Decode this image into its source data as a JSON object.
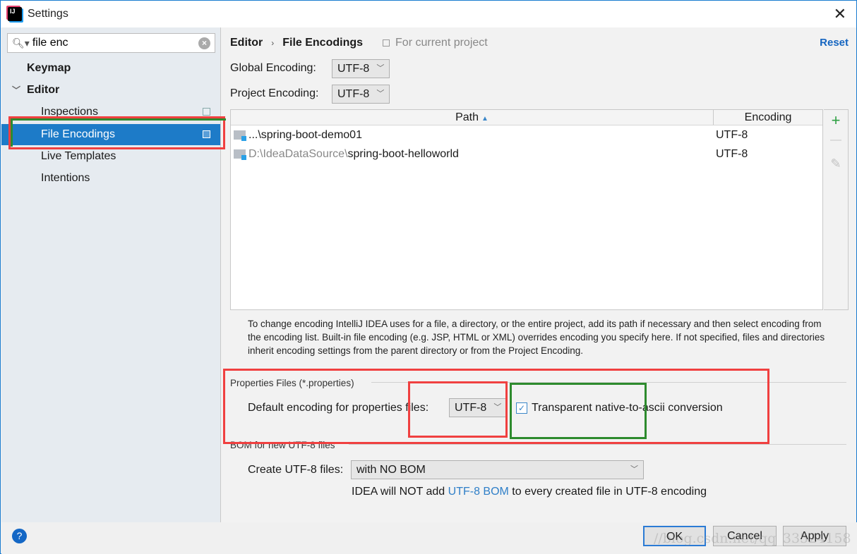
{
  "window": {
    "title": "Settings",
    "close_label": "✕"
  },
  "search": {
    "value": "file enc",
    "placeholder": ""
  },
  "sidebar": {
    "items": [
      {
        "label": "Keymap"
      },
      {
        "label": "Editor"
      },
      {
        "label": "Inspections"
      },
      {
        "label": "File Encodings"
      },
      {
        "label": "Live Templates"
      },
      {
        "label": "Intentions"
      }
    ]
  },
  "breadcrumb": {
    "parent": "Editor",
    "separator": "›",
    "current": "File Encodings",
    "scope": "For current project"
  },
  "reset_label": "Reset",
  "global_encoding": {
    "label": "Global Encoding:",
    "value": "UTF-8"
  },
  "project_encoding": {
    "label": "Project Encoding:",
    "value": "UTF-8"
  },
  "table": {
    "columns": {
      "path": "Path",
      "sort_indicator": "▲",
      "encoding": "Encoding"
    },
    "rows": [
      {
        "path_prefix": "...\\",
        "path_name": "spring-boot-demo01",
        "encoding": "UTF-8"
      },
      {
        "path_prefix": "D:\\IdeaDataSource\\",
        "path_name": "spring-boot-helloworld",
        "encoding": "UTF-8"
      }
    ],
    "tools": {
      "add": "+",
      "remove": "—",
      "edit": "✎"
    }
  },
  "help_text": "To change encoding IntelliJ IDEA uses for a file, a directory, or the entire project, add its path if necessary and then select encoding from the encoding list. Built-in file encoding (e.g. JSP, HTML or XML) overrides encoding you specify here. If not specified, files and directories inherit encoding settings from the parent directory or from the Project Encoding.",
  "properties": {
    "group_title": "Properties Files (*.properties)",
    "default_label": "Default encoding for properties files:",
    "default_value": "UTF-8",
    "native_to_ascii_label": "Transparent native-to-ascii conversion",
    "native_to_ascii_checked": true
  },
  "bom": {
    "group_title": "BOM for new UTF-8 files",
    "create_label": "Create UTF-8 files:",
    "create_value": "with NO BOM",
    "note_prefix": "IDEA will NOT add ",
    "note_link": "UTF-8 BOM",
    "note_suffix": " to every created file in UTF-8 encoding"
  },
  "footer": {
    "help": "?",
    "ok": "OK",
    "cancel": "Cancel",
    "apply": "Apply"
  },
  "watermark": "//blog.csdn.net/qq_33524158",
  "colors": {
    "accent": "#1d7bc8",
    "link": "#1565c0",
    "highlight_red": "#f04040",
    "highlight_green": "#2e8b2e"
  }
}
